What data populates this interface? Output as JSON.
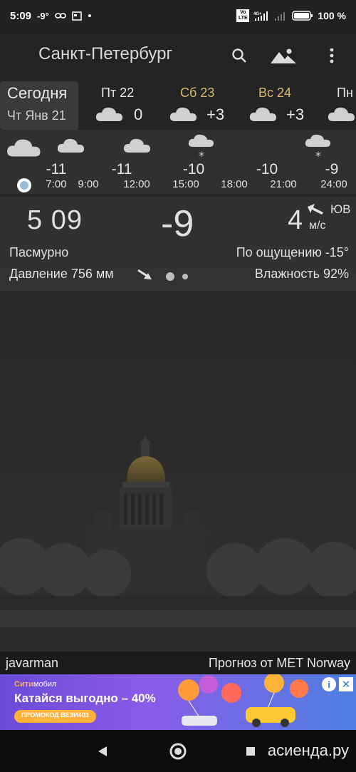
{
  "status": {
    "time": "5:09",
    "temp": "-9°",
    "battery": "100 %",
    "net": "4G+",
    "volte": "Vo LTE"
  },
  "app": {
    "city": "Санкт-Петербург",
    "icons": [
      "search-icon",
      "landscape-icon",
      "more-vert-icon"
    ]
  },
  "days": {
    "today": {
      "title": "Сегодня",
      "subtitle": "Чт Янв 21"
    },
    "items": [
      {
        "name": "Пт 22",
        "temp": "0",
        "weekend": false
      },
      {
        "name": "Сб 23",
        "temp": "+3",
        "weekend": true
      },
      {
        "name": "Вс 24",
        "temp": "+3",
        "weekend": true
      },
      {
        "name": "Пн",
        "temp": "",
        "weekend": false
      }
    ]
  },
  "hourly": [
    {
      "time": "7:00",
      "temp": "-11",
      "icon": "cloud-icon"
    },
    {
      "time": "9:00",
      "temp": "",
      "icon": "cloud-icon"
    },
    {
      "time": "12:00",
      "temp": "-11",
      "icon": "cloud-icon"
    },
    {
      "time": "15:00",
      "temp": "-10",
      "icon": "cloud-snow-icon"
    },
    {
      "time": "18:00",
      "temp": "",
      "icon": ""
    },
    {
      "time": "21:00",
      "temp": "-10",
      "icon": ""
    },
    {
      "time": "24:00",
      "temp": "-9",
      "icon": "cloud-snow-icon"
    }
  ],
  "current": {
    "time": "5 09",
    "temp": "-9",
    "wind_speed": "4",
    "wind_dir": "ЮВ",
    "wind_unit": "м/с",
    "condition": "Пасмурно",
    "feels_like": "По ощущению -15°",
    "pressure": "Давление 756 мм",
    "humidity": "Влажность 92%"
  },
  "footer": {
    "author": "javarman",
    "source": "Прогноз от MET Norway"
  },
  "ad": {
    "brand_a": "Сити",
    "brand_b": "мобил",
    "title": "Катайся выгодно – 40%",
    "promo": "ПРОМОКОД ВЕЗИ403",
    "info": "i",
    "close": "✕"
  },
  "nav": {
    "watermark": "асиенда.ру"
  },
  "colors": {
    "weekend": "#d8b86b",
    "panel": "#3a3a3a",
    "ad_bg": "#7a55e0",
    "accent_orange": "#ffb23a"
  }
}
